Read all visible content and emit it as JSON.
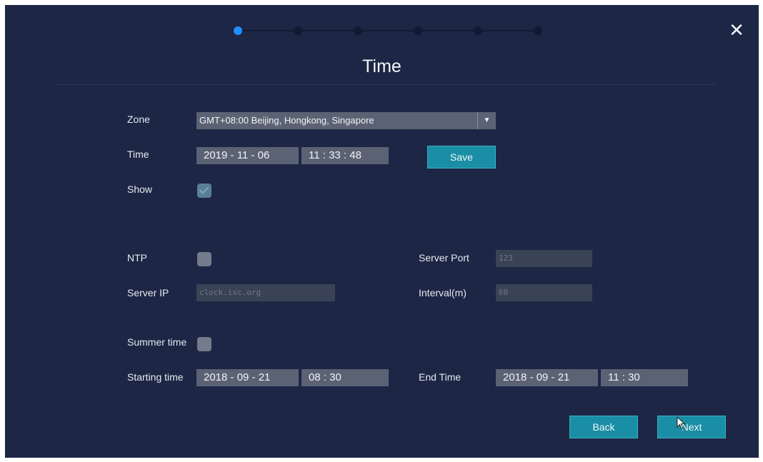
{
  "title": "Time",
  "close_glyph": "✕",
  "zone": {
    "label": "Zone",
    "value": "GMT+08:00 Beijing, Hongkong, Singapore",
    "arrow": "▼"
  },
  "time": {
    "label": "Time",
    "date": "2019 - 11 - 06",
    "clock": "11 : 33 : 48",
    "save_label": "Save"
  },
  "show": {
    "label": "Show",
    "checked": true
  },
  "ntp": {
    "label": "NTP",
    "checked": false,
    "server_ip_label": "Server IP",
    "server_ip_value": "clock.isc.org",
    "server_port_label": "Server Port",
    "server_port_value": "123",
    "interval_label": "Interval(m)",
    "interval_value": "60"
  },
  "summer_time": {
    "label": "Summer time",
    "checked": false,
    "start_label": "Starting time",
    "start_date": "2018 - 09 - 21",
    "start_clock": "08 : 30",
    "end_label": "End Time",
    "end_date": "2018 - 09 - 21",
    "end_clock": "11 : 30"
  },
  "buttons": {
    "back_label": "Back",
    "next_label": "Next"
  },
  "colors": {
    "background": "#1d2645",
    "accent": "#1a8ea4",
    "active_step": "#1e90ff"
  },
  "wizard": {
    "total_steps": 6,
    "active_step": 1
  }
}
